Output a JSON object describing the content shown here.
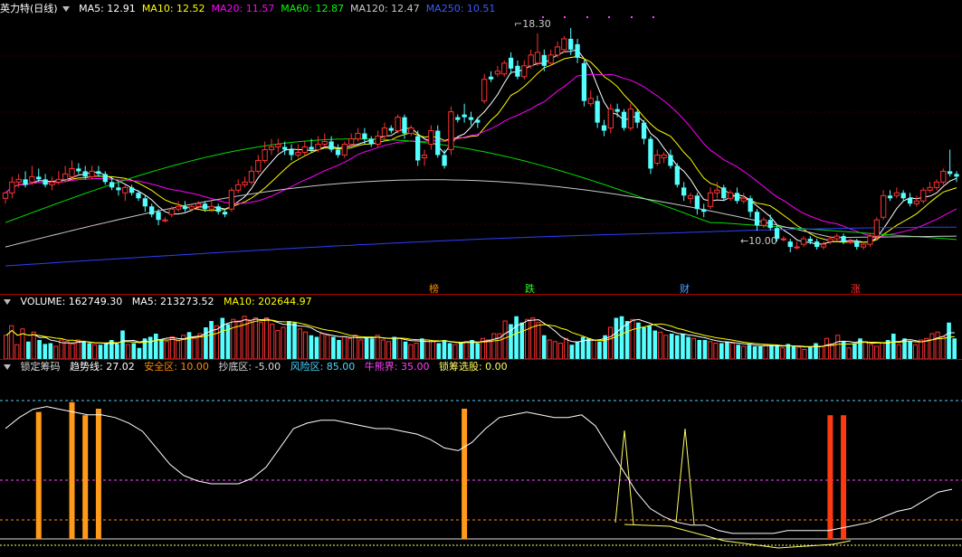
{
  "main": {
    "title": "英力特(日线)",
    "ma": [
      {
        "label": "MA5: 12.91",
        "color": "#ffffff"
      },
      {
        "label": "MA10: 12.52",
        "color": "#ffff00"
      },
      {
        "label": "MA20: 11.57",
        "color": "#ff00ff"
      },
      {
        "label": "MA60: 12.87",
        "color": "#00ff00"
      },
      {
        "label": "MA120: 12.47",
        "color": "#c8c8c8"
      },
      {
        "label": "MA250: 10.51",
        "color": "#3b5bff"
      }
    ],
    "high_label": "18.30",
    "low_label": "10.00",
    "events": [
      {
        "text": "榜",
        "color": "#ff8c00"
      },
      {
        "text": "跌",
        "color": "#22ff22"
      },
      {
        "text": "财",
        "color": "#4aa0ff"
      },
      {
        "text": "涨",
        "color": "#ff3030"
      }
    ]
  },
  "volume": {
    "label": "VOLUME: 162749.30",
    "ma5": "MA5: 213273.52",
    "ma10": "MA10: 202644.97"
  },
  "indicator": {
    "name": "锁定筹码",
    "trend": "趋势线: 27.02",
    "safe": "安全区: 10.00",
    "bottom": "抄底区: -5.00",
    "risk": "风险区: 85.00",
    "bull": "牛熊界: 35.00",
    "lock": "锁筹选股: 0.00"
  },
  "colors": {
    "up": "#ff3232",
    "down": "#54ffff",
    "bar_orange": "#ff9a1a",
    "bar_red": "#ff3a10"
  },
  "chart_data": {
    "type": "candlestick",
    "candles": [
      [
        12.2,
        12.0,
        11.8,
        12.2
      ],
      [
        12.6,
        12.2,
        12.0,
        12.8
      ],
      [
        12.7,
        12.6,
        12.4,
        12.9
      ],
      [
        12.5,
        12.7,
        12.4,
        13.0
      ],
      [
        12.8,
        12.6,
        12.5,
        13.2
      ],
      [
        12.7,
        12.8,
        12.6,
        13.1
      ],
      [
        12.5,
        12.7,
        12.4,
        12.9
      ],
      [
        12.6,
        12.5,
        12.3,
        12.8
      ],
      [
        12.7,
        12.6,
        12.5,
        13.0
      ],
      [
        12.9,
        12.7,
        12.6,
        13.2
      ],
      [
        13.1,
        12.8,
        12.7,
        13.4
      ],
      [
        13.0,
        13.1,
        12.9,
        13.3
      ],
      [
        12.8,
        13.0,
        12.7,
        13.2
      ],
      [
        13.0,
        12.8,
        12.7,
        13.2
      ],
      [
        12.9,
        13.0,
        12.8,
        13.2
      ],
      [
        12.6,
        12.9,
        12.5,
        13.0
      ],
      [
        12.4,
        12.6,
        12.3,
        12.8
      ],
      [
        12.3,
        12.4,
        12.1,
        12.6
      ],
      [
        12.4,
        12.2,
        11.9,
        12.5
      ],
      [
        12.2,
        12.4,
        12.1,
        12.5
      ],
      [
        12.0,
        12.2,
        11.9,
        12.3
      ],
      [
        11.7,
        12.0,
        11.5,
        12.1
      ],
      [
        11.4,
        11.7,
        11.3,
        11.8
      ],
      [
        11.2,
        11.5,
        11.0,
        11.6
      ],
      [
        11.2,
        11.2,
        11.1,
        11.3
      ],
      [
        11.6,
        11.4,
        11.3,
        11.7
      ],
      [
        11.7,
        11.6,
        11.5,
        11.9
      ],
      [
        11.6,
        11.7,
        11.5,
        11.9
      ],
      [
        11.7,
        11.6,
        11.5,
        11.8
      ],
      [
        11.8,
        11.7,
        11.6,
        11.9
      ],
      [
        11.6,
        11.8,
        11.5,
        11.9
      ],
      [
        11.7,
        11.6,
        11.5,
        11.9
      ],
      [
        11.5,
        11.7,
        11.4,
        11.8
      ],
      [
        11.4,
        11.5,
        11.3,
        11.6
      ],
      [
        12.3,
        11.6,
        11.5,
        12.4
      ],
      [
        12.5,
        12.3,
        12.2,
        12.7
      ],
      [
        12.6,
        12.5,
        12.4,
        12.8
      ],
      [
        13.0,
        12.6,
        12.5,
        13.2
      ],
      [
        13.4,
        13.0,
        12.9,
        13.6
      ],
      [
        13.8,
        13.4,
        13.3,
        14.1
      ],
      [
        13.9,
        13.8,
        13.6,
        14.2
      ],
      [
        14.0,
        13.9,
        13.7,
        14.2
      ],
      [
        13.8,
        13.9,
        13.6,
        14.1
      ],
      [
        13.6,
        13.8,
        13.4,
        14.0
      ],
      [
        13.7,
        13.6,
        13.5,
        14.0
      ],
      [
        13.9,
        13.7,
        13.6,
        14.1
      ],
      [
        13.8,
        13.9,
        13.7,
        14.2
      ],
      [
        14.0,
        13.8,
        13.7,
        14.3
      ],
      [
        14.1,
        14.0,
        13.9,
        14.4
      ],
      [
        13.8,
        14.1,
        13.7,
        14.3
      ],
      [
        13.6,
        13.8,
        13.5,
        14.0
      ],
      [
        14.0,
        13.6,
        13.5,
        14.1
      ],
      [
        14.2,
        14.0,
        13.9,
        14.4
      ],
      [
        14.4,
        14.2,
        14.1,
        14.6
      ],
      [
        14.2,
        14.4,
        14.0,
        14.6
      ],
      [
        14.0,
        14.2,
        13.9,
        14.3
      ],
      [
        14.3,
        14.0,
        13.9,
        14.5
      ],
      [
        14.6,
        14.3,
        14.2,
        14.8
      ],
      [
        14.5,
        14.6,
        14.4,
        14.7
      ],
      [
        15.0,
        14.5,
        14.4,
        15.1
      ],
      [
        14.4,
        15.0,
        14.2,
        15.1
      ],
      [
        14.6,
        14.4,
        14.3,
        14.7
      ],
      [
        13.4,
        14.3,
        13.2,
        14.5
      ],
      [
        13.6,
        13.5,
        13.2,
        13.8
      ],
      [
        14.5,
        14.0,
        13.8,
        14.7
      ],
      [
        13.6,
        14.5,
        13.5,
        14.7
      ],
      [
        13.2,
        13.6,
        13.1,
        13.8
      ],
      [
        15.2,
        13.8,
        13.6,
        15.4
      ],
      [
        14.9,
        15.0,
        14.8,
        15.1
      ],
      [
        15.0,
        15.1,
        14.8,
        15.5
      ],
      [
        14.9,
        15.0,
        14.7,
        15.2
      ],
      [
        14.8,
        14.9,
        14.6,
        15.0
      ],
      [
        16.4,
        15.6,
        15.5,
        16.6
      ],
      [
        16.4,
        16.5,
        16.3,
        16.7
      ],
      [
        16.7,
        16.6,
        16.5,
        16.9
      ],
      [
        17.0,
        16.6,
        16.5,
        17.1
      ],
      [
        16.8,
        17.2,
        16.6,
        17.4
      ],
      [
        16.5,
        16.9,
        16.4,
        17.1
      ],
      [
        16.9,
        16.5,
        16.4,
        17.1
      ],
      [
        17.3,
        16.9,
        16.8,
        17.5
      ],
      [
        17.4,
        17.0,
        16.9,
        18.1
      ],
      [
        16.9,
        17.3,
        16.7,
        17.5
      ],
      [
        17.3,
        17.0,
        16.9,
        17.5
      ],
      [
        17.6,
        17.3,
        17.2,
        17.8
      ],
      [
        17.9,
        17.5,
        17.4,
        18.0
      ],
      [
        17.5,
        17.9,
        17.3,
        18.3
      ],
      [
        17.2,
        17.7,
        17.0,
        17.9
      ],
      [
        15.6,
        17.0,
        15.4,
        17.1
      ],
      [
        15.7,
        15.5,
        15.4,
        16.0
      ],
      [
        14.8,
        15.6,
        14.6,
        15.8
      ],
      [
        14.5,
        14.7,
        14.3,
        14.9
      ],
      [
        15.3,
        14.6,
        14.4,
        15.5
      ],
      [
        15.2,
        15.3,
        15.0,
        15.5
      ],
      [
        14.6,
        15.2,
        14.5,
        15.3
      ],
      [
        15.3,
        14.6,
        14.5,
        15.5
      ],
      [
        14.8,
        15.2,
        14.6,
        15.3
      ],
      [
        14.2,
        14.8,
        14.0,
        14.9
      ],
      [
        13.1,
        14.2,
        12.9,
        14.3
      ],
      [
        13.6,
        13.3,
        13.2,
        13.8
      ],
      [
        13.6,
        13.5,
        13.3,
        13.7
      ],
      [
        13.2,
        13.6,
        13.1,
        13.8
      ],
      [
        12.5,
        13.2,
        12.4,
        13.3
      ],
      [
        12.1,
        12.4,
        11.9,
        12.6
      ],
      [
        12.1,
        12.0,
        11.8,
        12.2
      ],
      [
        11.6,
        12.1,
        11.4,
        12.2
      ],
      [
        11.5,
        11.6,
        11.3,
        11.8
      ],
      [
        12.2,
        11.7,
        11.6,
        12.4
      ],
      [
        12.3,
        12.2,
        12.0,
        12.6
      ],
      [
        12.0,
        12.4,
        11.9,
        12.5
      ],
      [
        12.2,
        12.0,
        11.9,
        12.3
      ],
      [
        11.9,
        12.2,
        11.8,
        12.4
      ],
      [
        12.0,
        11.9,
        11.8,
        12.2
      ],
      [
        11.5,
        12.0,
        11.3,
        12.1
      ],
      [
        11.0,
        11.5,
        10.8,
        11.6
      ],
      [
        11.2,
        11.0,
        10.9,
        11.3
      ],
      [
        10.9,
        11.2,
        10.8,
        11.4
      ],
      [
        10.5,
        10.9,
        10.4,
        11.0
      ],
      [
        10.5,
        10.5,
        10.4,
        10.6
      ],
      [
        10.2,
        10.4,
        10.0,
        10.5
      ],
      [
        10.2,
        10.2,
        10.1,
        10.4
      ],
      [
        10.5,
        10.3,
        10.2,
        10.6
      ],
      [
        10.4,
        10.5,
        10.3,
        10.6
      ],
      [
        10.2,
        10.4,
        10.1,
        10.5
      ],
      [
        10.3,
        10.2,
        10.1,
        10.4
      ],
      [
        10.5,
        10.4,
        10.3,
        10.6
      ],
      [
        10.6,
        10.5,
        10.4,
        10.7
      ],
      [
        10.4,
        10.6,
        10.3,
        10.7
      ],
      [
        10.4,
        10.4,
        10.3,
        10.5
      ],
      [
        10.2,
        10.4,
        10.1,
        10.5
      ],
      [
        10.3,
        10.2,
        10.1,
        10.4
      ],
      [
        10.6,
        10.3,
        10.2,
        10.7
      ],
      [
        11.2,
        10.6,
        10.5,
        11.3
      ],
      [
        12.1,
        11.3,
        11.2,
        12.3
      ],
      [
        12.0,
        12.1,
        11.9,
        12.3
      ],
      [
        12.2,
        12.1,
        12.0,
        12.4
      ],
      [
        12.0,
        12.2,
        11.9,
        12.3
      ],
      [
        11.8,
        12.0,
        11.7,
        12.2
      ],
      [
        11.9,
        11.8,
        11.7,
        12.1
      ],
      [
        12.3,
        11.9,
        11.8,
        12.4
      ],
      [
        12.4,
        12.3,
        12.2,
        12.6
      ],
      [
        12.6,
        12.4,
        12.3,
        12.7
      ],
      [
        13.0,
        12.6,
        12.5,
        13.1
      ],
      [
        12.9,
        13.0,
        12.8,
        13.8
      ],
      [
        12.8,
        12.9,
        12.6,
        13.0
      ]
    ],
    "volume": [
      150,
      210,
      90,
      190,
      110,
      170,
      120,
      95,
      100,
      80,
      120,
      110,
      95,
      120,
      110,
      100,
      90,
      90,
      95,
      120,
      95,
      180,
      90,
      100,
      70,
      130,
      140,
      160,
      120,
      110,
      140,
      115,
      150,
      170,
      130,
      160,
      200,
      240,
      210,
      260,
      220,
      250,
      240,
      270,
      240,
      260,
      230,
      260,
      220,
      180,
      200,
      240,
      230,
      190,
      170,
      150,
      140,
      160,
      150,
      140,
      120,
      140,
      130,
      150,
      120,
      140,
      130,
      150,
      120,
      110,
      140,
      130,
      110,
      90,
      100,
      130,
      120,
      110,
      100,
      120,
      100,
      90,
      100,
      110,
      120,
      100,
      130,
      120,
      160,
      160,
      240,
      220,
      270,
      230,
      250,
      260,
      230,
      150,
      120,
      110,
      100,
      130,
      90,
      110,
      140,
      130,
      120,
      110,
      150,
      200,
      260,
      270,
      240,
      250,
      230,
      200,
      210,
      180,
      170,
      150,
      160,
      150,
      160,
      140,
      130,
      120,
      120,
      110,
      100,
      100,
      110,
      100,
      90,
      80,
      90,
      80,
      80,
      90,
      85,
      80,
      70,
      95,
      80,
      75,
      60,
      75,
      100,
      80,
      130,
      90,
      150,
      110,
      70,
      100,
      130,
      110,
      90,
      80,
      100,
      120,
      160,
      90,
      130,
      110,
      90,
      120,
      130,
      160,
      170,
      140,
      230,
      130
    ],
    "trend": [
      40,
      44,
      47,
      48,
      47,
      46,
      45,
      45,
      44,
      42,
      39,
      33,
      27,
      23,
      21,
      20,
      20,
      20,
      22,
      26,
      33,
      40,
      42,
      43,
      43,
      42,
      41,
      40,
      40,
      39,
      38,
      36,
      33,
      32,
      35,
      40,
      44,
      45,
      46,
      45,
      44,
      44,
      45,
      41,
      33,
      25,
      17,
      11,
      8,
      6,
      5,
      5,
      3,
      2,
      2,
      2,
      2,
      3,
      3,
      3,
      3,
      4,
      5,
      6,
      8,
      10,
      11,
      14,
      17,
      18
    ],
    "bars": [
      {
        "i": 5,
        "h": 39,
        "c": "orange"
      },
      {
        "i": 10,
        "h": 42,
        "c": "orange"
      },
      {
        "i": 12,
        "h": 38,
        "c": "orange"
      },
      {
        "i": 14,
        "h": 40,
        "c": "orange"
      },
      {
        "i": 69,
        "h": 40,
        "c": "orange"
      },
      {
        "i": 124,
        "h": 38,
        "c": "red"
      },
      {
        "i": 126,
        "h": 38,
        "c": "red"
      }
    ]
  }
}
